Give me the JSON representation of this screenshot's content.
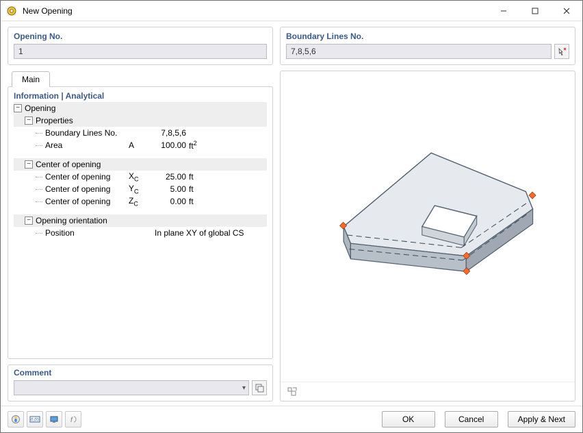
{
  "window": {
    "title": "New Opening"
  },
  "opening_no": {
    "label": "Opening No.",
    "value": "1"
  },
  "boundary_lines": {
    "label": "Boundary Lines No.",
    "value": "7,8,5,6"
  },
  "tabs": {
    "main": "Main"
  },
  "tree": {
    "title": "Information | Analytical",
    "opening": {
      "label": "Opening",
      "properties": {
        "label": "Properties",
        "boundary": {
          "name": "Boundary Lines No.",
          "sym": "",
          "value": "7,8,5,6",
          "unit": ""
        },
        "area": {
          "name": "Area",
          "sym": "A",
          "value": "100.00",
          "unit": "ft2"
        }
      },
      "center": {
        "label": "Center of opening",
        "xc": {
          "name": "Center of opening",
          "sym": "XC",
          "value": "25.00",
          "unit": "ft"
        },
        "yc": {
          "name": "Center of opening",
          "sym": "YC",
          "value": "5.00",
          "unit": "ft"
        },
        "zc": {
          "name": "Center of opening",
          "sym": "ZC",
          "value": "0.00",
          "unit": "ft"
        }
      },
      "orientation": {
        "label": "Opening orientation",
        "position": {
          "name": "Position",
          "value": "In plane XY of global CS"
        }
      }
    }
  },
  "comment": {
    "label": "Comment",
    "value": ""
  },
  "footer": {
    "ok": "OK",
    "cancel": "Cancel",
    "apply_next": "Apply & Next"
  }
}
